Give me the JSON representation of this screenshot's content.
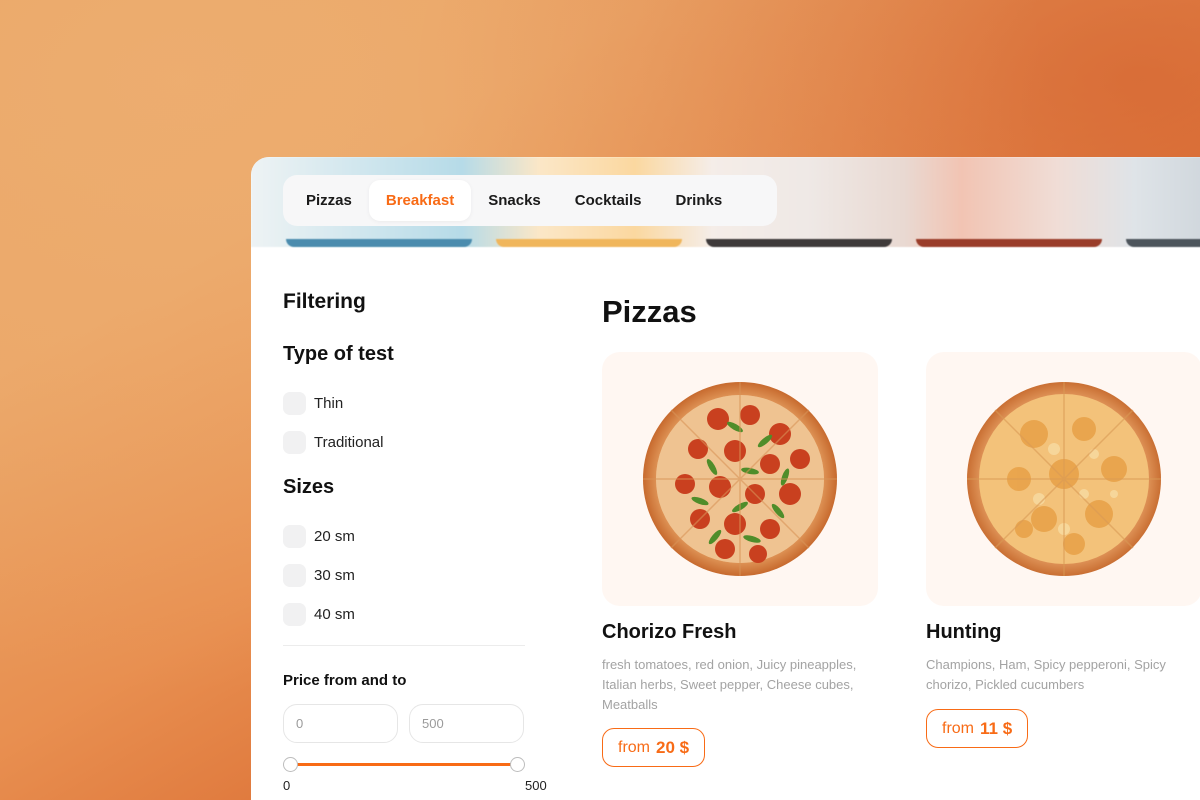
{
  "tabs": [
    "Pizzas",
    "Breakfast",
    "Snacks",
    "Cocktails",
    "Drinks"
  ],
  "active_tab": "Breakfast",
  "filter": {
    "title": "Filtering",
    "type_group": {
      "title": "Type of test",
      "options": [
        "Thin",
        "Traditional"
      ]
    },
    "size_group": {
      "title": "Sizes",
      "options": [
        "20 sm",
        "30 sm",
        "40 sm"
      ]
    },
    "price": {
      "title": "Price from and to",
      "from_placeholder": "0",
      "to_placeholder": "500",
      "slider_min_label": "0",
      "slider_max_label": "500"
    }
  },
  "main": {
    "title": "Pizzas",
    "products": [
      {
        "name": "Chorizo Fresh",
        "description": "fresh tomatoes, red onion, Juicy pineapples, Italian herbs, Sweet pepper, Cheese cubes, Meatballs",
        "price_prefix": "from",
        "price": "20 $"
      },
      {
        "name": "Hunting",
        "description": "Champions, Ham, Spicy pepperoni, Spicy chorizo, Pickled cucumbers",
        "price_prefix": "from",
        "price": "11 $"
      }
    ]
  },
  "colors": {
    "accent": "#f86b16",
    "background_gradient": [
      "#e9a464",
      "#d9692f"
    ]
  }
}
